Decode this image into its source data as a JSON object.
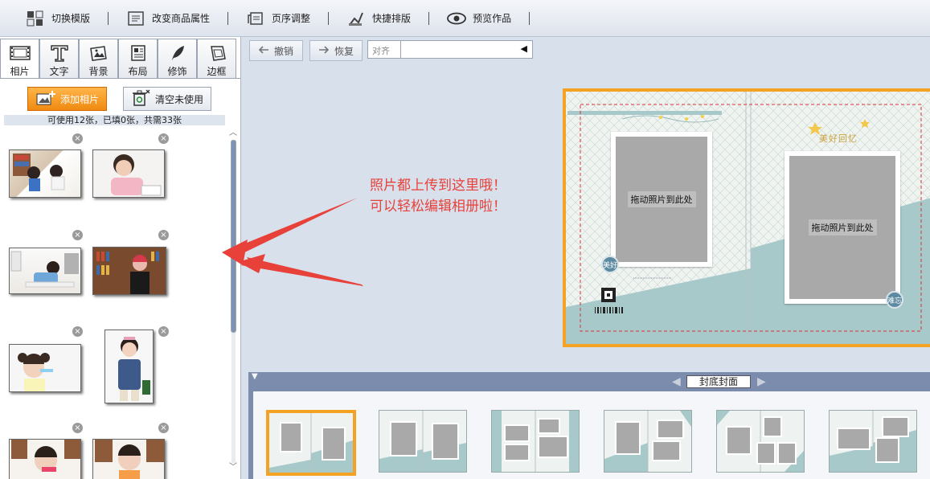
{
  "toolbar": {
    "items": [
      {
        "label": "切换模版",
        "icon": "switch-template-icon"
      },
      {
        "label": "改变商品属性",
        "icon": "product-attributes-icon"
      },
      {
        "label": "页序调整",
        "icon": "page-order-icon"
      },
      {
        "label": "快捷排版",
        "icon": "quick-layout-icon"
      },
      {
        "label": "预览作品",
        "icon": "eye-icon"
      }
    ]
  },
  "side_tabs": [
    {
      "label": "相片",
      "icon": "film-icon",
      "active": true
    },
    {
      "label": "文字",
      "icon": "text-icon"
    },
    {
      "label": "背景",
      "icon": "background-icon"
    },
    {
      "label": "布局",
      "icon": "layout-icon"
    },
    {
      "label": "修饰",
      "icon": "feather-icon"
    },
    {
      "label": "边框",
      "icon": "frame-icon"
    }
  ],
  "photos_panel": {
    "add_label": "添加相片",
    "clear_label": "清空未使用",
    "status": "可使用12张，已填0张，共需33张",
    "delete_glyph": "×"
  },
  "editor": {
    "undo_label": "撤销",
    "redo_label": "恢复",
    "align_label": "对齐"
  },
  "callout": {
    "line1": "照片都上传到这里哦！",
    "line2": "可以轻松编辑相册啦！"
  },
  "spread": {
    "drop_left": "拖动照片到此处",
    "drop_right": "拖动照片到此处",
    "circle_left": "美好",
    "circle_right": "难忘",
    "heading": "美好回忆"
  },
  "filmstrip": {
    "page_label": "封底封面"
  },
  "colors": {
    "accent_orange": "#f3a223",
    "callout_red": "#e8413a",
    "teal": "#a7c9c9"
  }
}
